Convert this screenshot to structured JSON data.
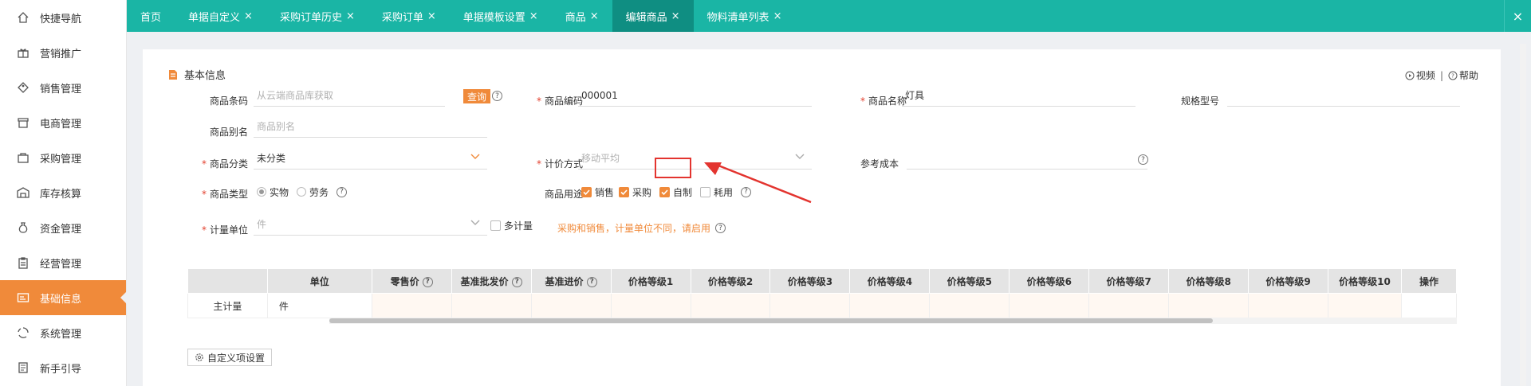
{
  "sidebar": {
    "items": [
      {
        "label": "快捷导航",
        "icon": "home-icon"
      },
      {
        "label": "营销推广",
        "icon": "gift-icon"
      },
      {
        "label": "销售管理",
        "icon": "tag-icon"
      },
      {
        "label": "电商管理",
        "icon": "store-icon"
      },
      {
        "label": "采购管理",
        "icon": "bag-icon"
      },
      {
        "label": "库存核算",
        "icon": "warehouse-icon"
      },
      {
        "label": "资金管理",
        "icon": "money-bag-icon"
      },
      {
        "label": "经营管理",
        "icon": "clipboard-icon"
      },
      {
        "label": "基础信息",
        "icon": "id-card-icon",
        "active": true
      },
      {
        "label": "系统管理",
        "icon": "cycle-icon"
      },
      {
        "label": "新手引导",
        "icon": "book-icon"
      }
    ]
  },
  "tabs": [
    {
      "label": "首页",
      "closable": false
    },
    {
      "label": "单据自定义",
      "closable": true
    },
    {
      "label": "采购订单历史",
      "closable": true
    },
    {
      "label": "采购订单",
      "closable": true
    },
    {
      "label": "单据模板设置",
      "closable": true
    },
    {
      "label": "商品",
      "closable": true
    },
    {
      "label": "编辑商品",
      "closable": true,
      "active": true
    },
    {
      "label": "物料清单列表",
      "closable": true
    }
  ],
  "tab_close_symbol": "×",
  "section": {
    "title": "基本信息"
  },
  "help": {
    "video": "视频",
    "separator": "|",
    "help": "帮助"
  },
  "form": {
    "barcode": {
      "label": "商品条码",
      "placeholder": "从云端商品库获取",
      "query_btn": "查询"
    },
    "code": {
      "label": "商品编码",
      "value": "000001"
    },
    "name": {
      "label": "商品名称",
      "value": "灯具"
    },
    "spec": {
      "label": "规格型号",
      "value": ""
    },
    "alias": {
      "label": "商品别名",
      "placeholder": "商品别名"
    },
    "category": {
      "label": "商品分类",
      "value": "未分类"
    },
    "pricing": {
      "label": "计价方式",
      "value": "移动平均"
    },
    "ref_cost": {
      "label": "参考成本",
      "value": ""
    },
    "type": {
      "label": "商品类型",
      "options": [
        "实物",
        "劳务"
      ],
      "selected": "实物"
    },
    "usage": {
      "label": "商品用途",
      "options": [
        {
          "label": "销售",
          "checked": true
        },
        {
          "label": "采购",
          "checked": true
        },
        {
          "label": "自制",
          "checked": true
        },
        {
          "label": "耗用",
          "checked": false
        }
      ]
    },
    "unit": {
      "label": "计量单位",
      "value": "件",
      "multi_label": "多计量",
      "warning": "采购和销售，计量单位不同，请启用"
    }
  },
  "required_mark": "*",
  "help_mark": "?",
  "table": {
    "headers": [
      "",
      "单位",
      "零售价",
      "基准批发价",
      "基准进价",
      "价格等级1",
      "价格等级2",
      "价格等级3",
      "价格等级4",
      "价格等级5",
      "价格等级6",
      "价格等级7",
      "价格等级8",
      "价格等级9",
      "价格等级10",
      "操作"
    ],
    "row": {
      "name": "主计量",
      "unit": "件"
    }
  },
  "custom_btn": "自定义项设置",
  "colors": {
    "accent": "#f08a3a",
    "tabbar": "#1ab5a5",
    "tab_active": "#0f8e82",
    "highlight": "#e3342f"
  }
}
